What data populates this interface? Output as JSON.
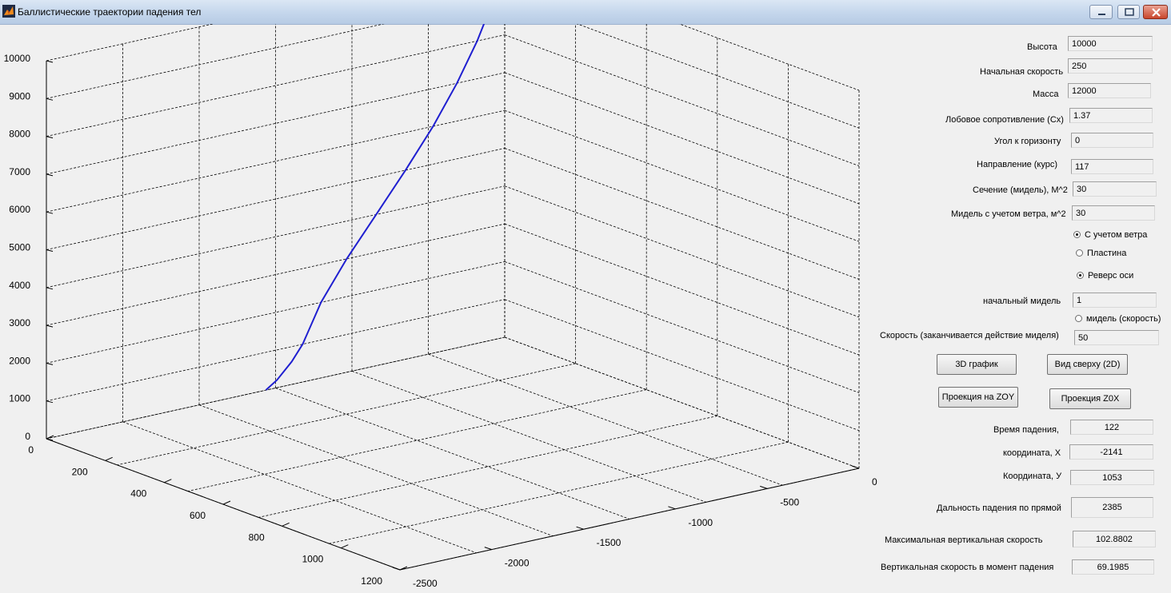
{
  "window": {
    "title": "Баллистические траектории падения тел",
    "icon": "matlab-icon",
    "controls": [
      "minimize-icon",
      "maximize-icon",
      "close-icon"
    ]
  },
  "plot": {
    "z_ticks": [
      "0",
      "1000",
      "2000",
      "3000",
      "4000",
      "5000",
      "6000",
      "7000",
      "8000",
      "9000",
      "10000"
    ],
    "left_ticks": [
      "0",
      "200",
      "400",
      "600",
      "800",
      "1000",
      "1200"
    ],
    "right_ticks": [
      "0",
      "-500",
      "-1000",
      "-1500",
      "-2000",
      "-2500"
    ],
    "trajectory_color": "#1f1fd0",
    "trajectory_points": [
      [
        0,
        0,
        10000
      ],
      [
        0,
        -60,
        9000
      ],
      [
        0,
        -150,
        8000
      ],
      [
        0,
        -260,
        7000
      ],
      [
        0,
        -390,
        6000
      ],
      [
        0,
        -540,
        5000
      ],
      [
        0,
        -700,
        4000
      ],
      [
        0,
        -860,
        3000
      ],
      [
        0,
        -1000,
        2000
      ],
      [
        0,
        -1100,
        1000
      ],
      [
        0,
        -1160,
        600
      ],
      [
        0,
        -1240,
        200
      ],
      [
        0,
        -1300,
        0
      ]
    ]
  },
  "params": {
    "height_label": "Высота",
    "height_value": "10000",
    "speed_label": "Начальная скорость",
    "speed_value": "250",
    "mass_label": "Масса",
    "mass_value": "12000",
    "drag_label": "Лобовое сопротивление (Cx)",
    "drag_value": "1.37",
    "angle_label": "Угол к горизонту",
    "angle_value": "0",
    "course_label": "Направление  (курс)",
    "course_value": "117",
    "section_label": "Сечение (мидель), M^2",
    "section_value": "30",
    "wind_section_label": "Мидель с учетом ветра, м^2",
    "wind_section_value": "30"
  },
  "radios": {
    "wind": "С учетом ветра",
    "plate": "Пластина",
    "reverse": "Реверс оси",
    "midel_speed": "мидель (скорость)"
  },
  "midel": {
    "initial_label": "начальный мидель",
    "initial_value": "1",
    "speed_label": "Скорость (заканчивается действие миделя)",
    "speed_value": "50"
  },
  "buttons": {
    "plot3d": "3D график",
    "top_view": "Вид сверху (2D)",
    "proj_zoy": "Проекция на ZOY",
    "proj_zox": "Проекция Z0X"
  },
  "results": {
    "time_label": "Время падения,",
    "time_value": "122",
    "x_label": "координата, X",
    "x_value": "-2141",
    "y_label": "Координата, У",
    "y_value": "1053",
    "range_label": "Дальность падения по прямой",
    "range_value": "2385",
    "max_vspeed_label": "Максимальная вертикальная скорость",
    "max_vspeed_value": "102.8802",
    "impact_vspeed_label": "Вертикальная  скорость в момент падения",
    "impact_vspeed_value": "69.1985"
  }
}
